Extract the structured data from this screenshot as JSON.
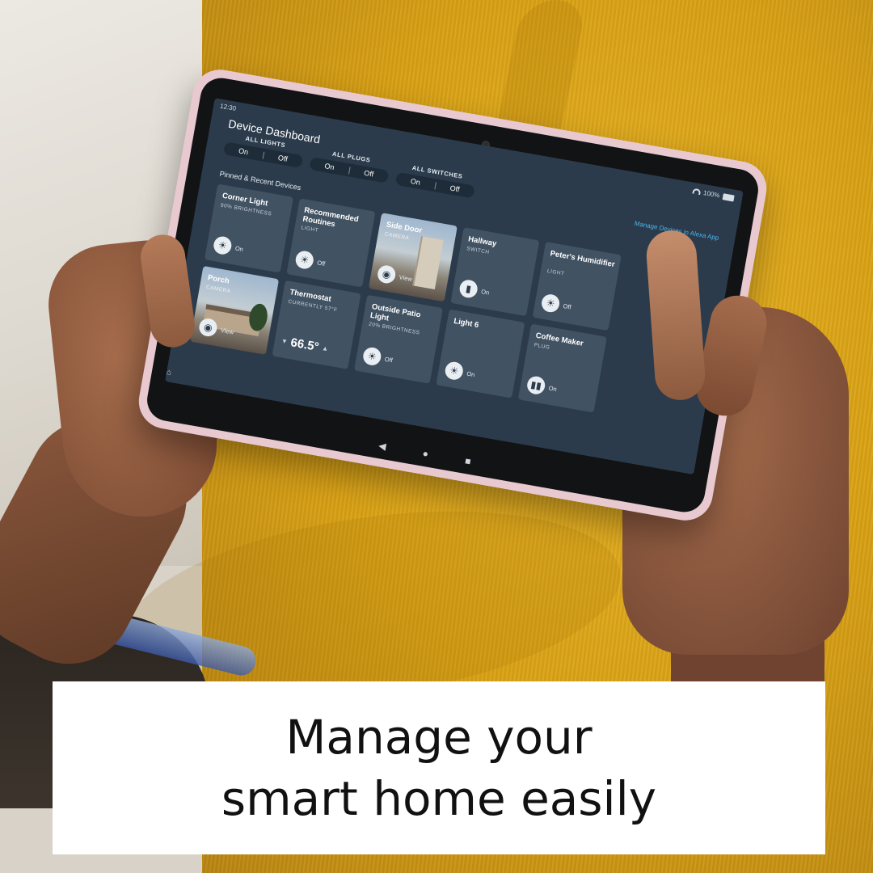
{
  "caption": {
    "line1": "Manage your",
    "line2": "smart home easily"
  },
  "status_bar": {
    "time": "12:30",
    "battery": "100%"
  },
  "dashboard": {
    "title": "Device Dashboard",
    "manage_link": "Manage Devices in Alexa App",
    "pinned_label": "Pinned & Recent Devices",
    "groups": [
      {
        "label": "ALL LIGHTS",
        "on": "On",
        "off": "Off"
      },
      {
        "label": "ALL PLUGS",
        "on": "On",
        "off": "Off"
      },
      {
        "label": "ALL SWITCHES",
        "on": "On",
        "off": "Off"
      }
    ],
    "tiles": [
      {
        "name": "Corner Light",
        "sub": "90% BRIGHTNESS",
        "state": "On",
        "icon": "bulb-icon"
      },
      {
        "name": "Recommended Routines",
        "sub": "LIGHT",
        "state": "Off",
        "icon": "bulb-icon"
      },
      {
        "name": "Side Door",
        "sub": "CAMERA",
        "state": "View",
        "icon": "camera-icon"
      },
      {
        "name": "Hallway",
        "sub": "SWITCH",
        "state": "On",
        "icon": "switch-icon"
      },
      {
        "name": "Peter's Humidifier",
        "sub": "LIGHT",
        "state": "Off",
        "icon": "bulb-icon"
      },
      {
        "name": "Porch",
        "sub": "CAMERA",
        "state": "View",
        "icon": "camera-icon"
      },
      {
        "name": "Thermostat",
        "sub": "CURRENTLY 57°F",
        "temp": "66.5°",
        "icon": "thermostat-icon"
      },
      {
        "name": "Outside Patio Light",
        "sub": "20% BRIGHTNESS",
        "state": "Off",
        "icon": "bulb-icon"
      },
      {
        "name": "Light 6",
        "sub": "",
        "state": "On",
        "icon": "bulb-icon"
      },
      {
        "name": "Coffee Maker",
        "sub": "PLUG",
        "state": "On",
        "icon": "plug-icon"
      }
    ]
  },
  "colors": {
    "screen_bg": "#2b3b4b",
    "tile_bg": "#415263",
    "link": "#49b6f2",
    "tablet_shell": "#e8c9d0",
    "shirt": "#d9a114"
  }
}
